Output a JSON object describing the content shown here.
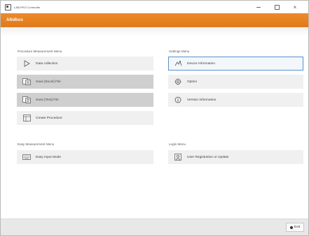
{
  "window": {
    "title": "LAB-PKG Controller",
    "controls": {
      "minimize": "",
      "maximize": "",
      "close": "×"
    }
  },
  "header": {
    "title": "ANdbox"
  },
  "procedure_menu": {
    "label": "Procedure Measurement Menu",
    "items": [
      {
        "label": "Data collection",
        "icon": "play-triangle-icon",
        "state": "normal"
      },
      {
        "label": "Save [Excel] File",
        "icon": "excel-file-icon",
        "state": "disabled"
      },
      {
        "label": "Save [Text] File",
        "icon": "text-file-icon",
        "state": "disabled"
      },
      {
        "label": "Create Procedure",
        "icon": "procedure-icon",
        "state": "normal"
      }
    ]
  },
  "settings_menu": {
    "label": "Settings Menu",
    "items": [
      {
        "label": "Device Information",
        "icon": "device-info-icon",
        "state": "selected"
      },
      {
        "label": "Option",
        "icon": "gear-icon",
        "state": "normal"
      },
      {
        "label": "Version Information",
        "icon": "info-icon",
        "state": "normal"
      }
    ]
  },
  "easy_menu": {
    "label": "Easy Measurement Menu",
    "items": [
      {
        "label": "Easy Input Mode",
        "icon": "keyboard-icon",
        "state": "normal"
      }
    ]
  },
  "login_menu": {
    "label": "Login Menu",
    "items": [
      {
        "label": "User Registration or Update",
        "icon": "user-icon",
        "state": "normal"
      }
    ]
  },
  "footer": {
    "exit_label": "Exit"
  },
  "colors": {
    "accent": "#e67e22",
    "selected_border": "#5a8fd0",
    "disabled_bg": "#cfcfcf",
    "button_bg": "#f0f0f0"
  }
}
